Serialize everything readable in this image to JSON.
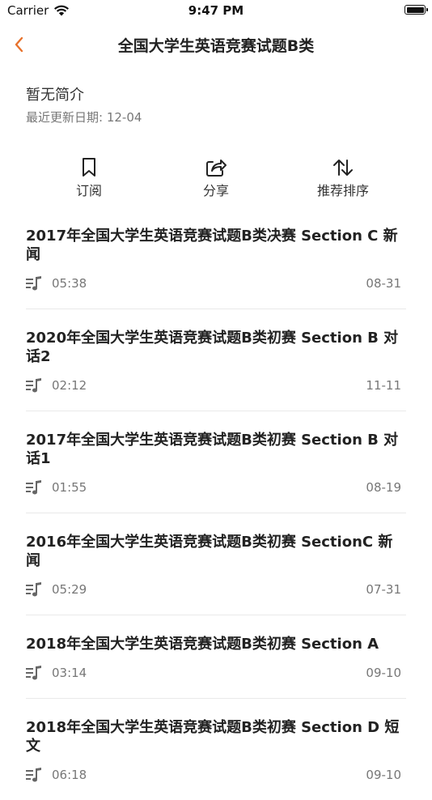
{
  "status_bar": {
    "carrier": "Carrier",
    "time": "9:47 PM"
  },
  "nav": {
    "title": "全国大学生英语竞赛试题B类",
    "accent_color": "#E8722C"
  },
  "album": {
    "description": "暂无简介",
    "update_label": "最近更新日期: 12-04"
  },
  "actions": {
    "subscribe": "订阅",
    "share": "分享",
    "sort": "推荐排序"
  },
  "episodes": [
    {
      "title": "2017年全国大学生英语竞赛试题B类决赛 Section C 新闻",
      "duration": "05:38",
      "date": "08-31"
    },
    {
      "title": "2020年全国大学生英语竞赛试题B类初赛 Section B 对话2",
      "duration": "02:12",
      "date": "11-11"
    },
    {
      "title": "2017年全国大学生英语竞赛试题B类初赛 Section B 对话1",
      "duration": "01:55",
      "date": "08-19"
    },
    {
      "title": "2016年全国大学生英语竞赛试题B类初赛 SectionC 新闻",
      "duration": "05:29",
      "date": "07-31"
    },
    {
      "title": "2018年全国大学生英语竞赛试题B类初赛 Section A",
      "duration": "03:14",
      "date": "09-10"
    },
    {
      "title": "2018年全国大学生英语竞赛试题B类初赛 Section D 短文",
      "duration": "06:18",
      "date": "09-10"
    }
  ]
}
